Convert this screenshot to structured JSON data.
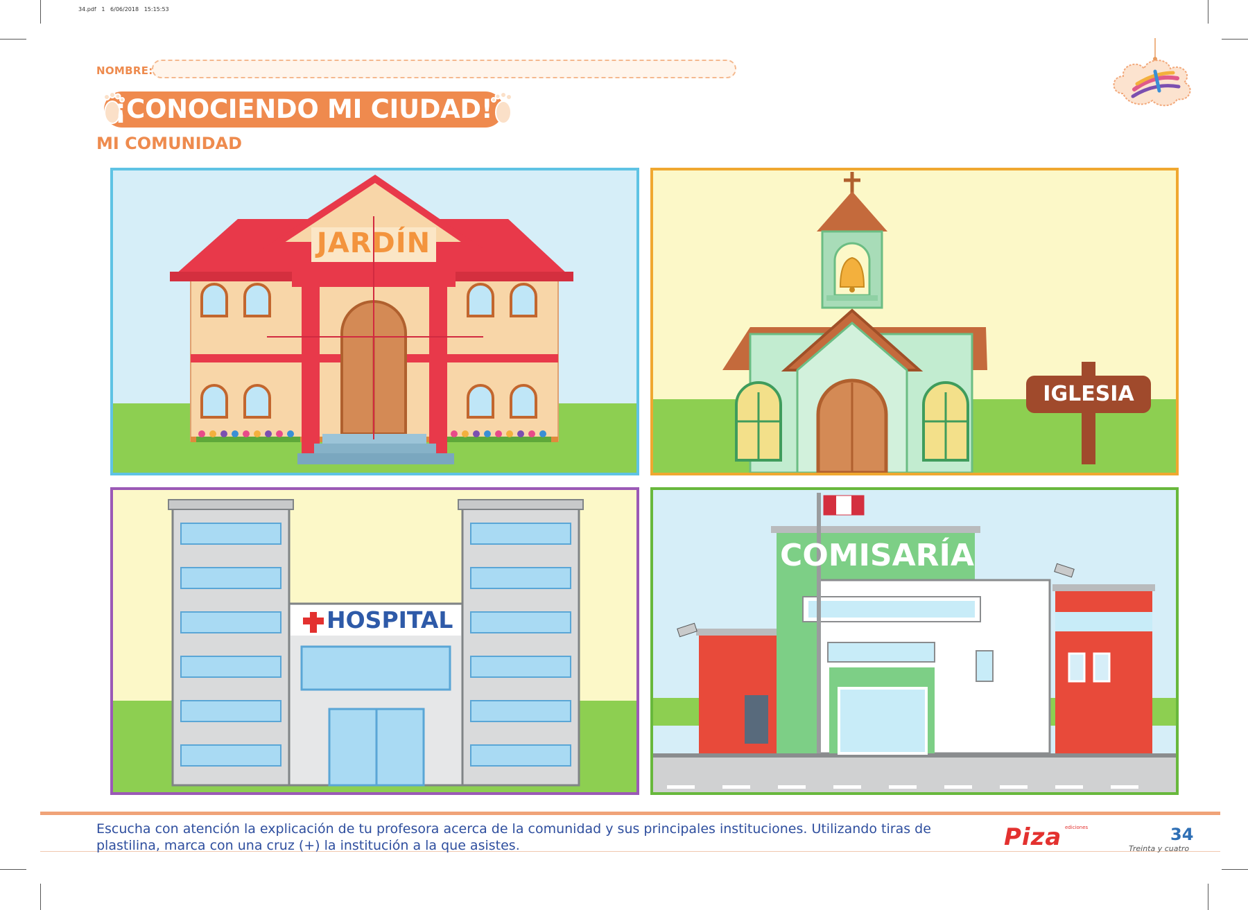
{
  "header": {
    "print_meta": "34.pdf   1   6/06/2018   15:15:53",
    "name_label": "NOMBRE:",
    "title": "¡CONOCIENDO MI CIUDAD!",
    "subtitle": "MI COMUNIDAD"
  },
  "panels": {
    "jardin": {
      "sign": "JARDÍN",
      "border_color": "#5fc3e4"
    },
    "iglesia": {
      "sign": "IGLESIA",
      "border_color": "#f0a830"
    },
    "hospital": {
      "sign": "HOSPITAL",
      "border_color": "#9b59b6"
    },
    "comisaria": {
      "sign": "COMISARÍA",
      "border_color": "#68b83c"
    }
  },
  "footer": {
    "instructions": "Escucha con atención la explicación de tu profesora acerca de la comunidad y sus principales instituciones. Utilizando tiras de plastilina, marca con una cruz (+) la institución a la que asistes.",
    "brand_small": "ediciones",
    "brand": "Piza",
    "page_number": "34",
    "page_words": "Treinta y cuatro"
  },
  "colors": {
    "accent_orange": "#ef8a4e",
    "text_blue": "#2e4e9e",
    "sky": "#d6eef8",
    "cream": "#fcf8c8",
    "grass": "#8dcf51"
  }
}
